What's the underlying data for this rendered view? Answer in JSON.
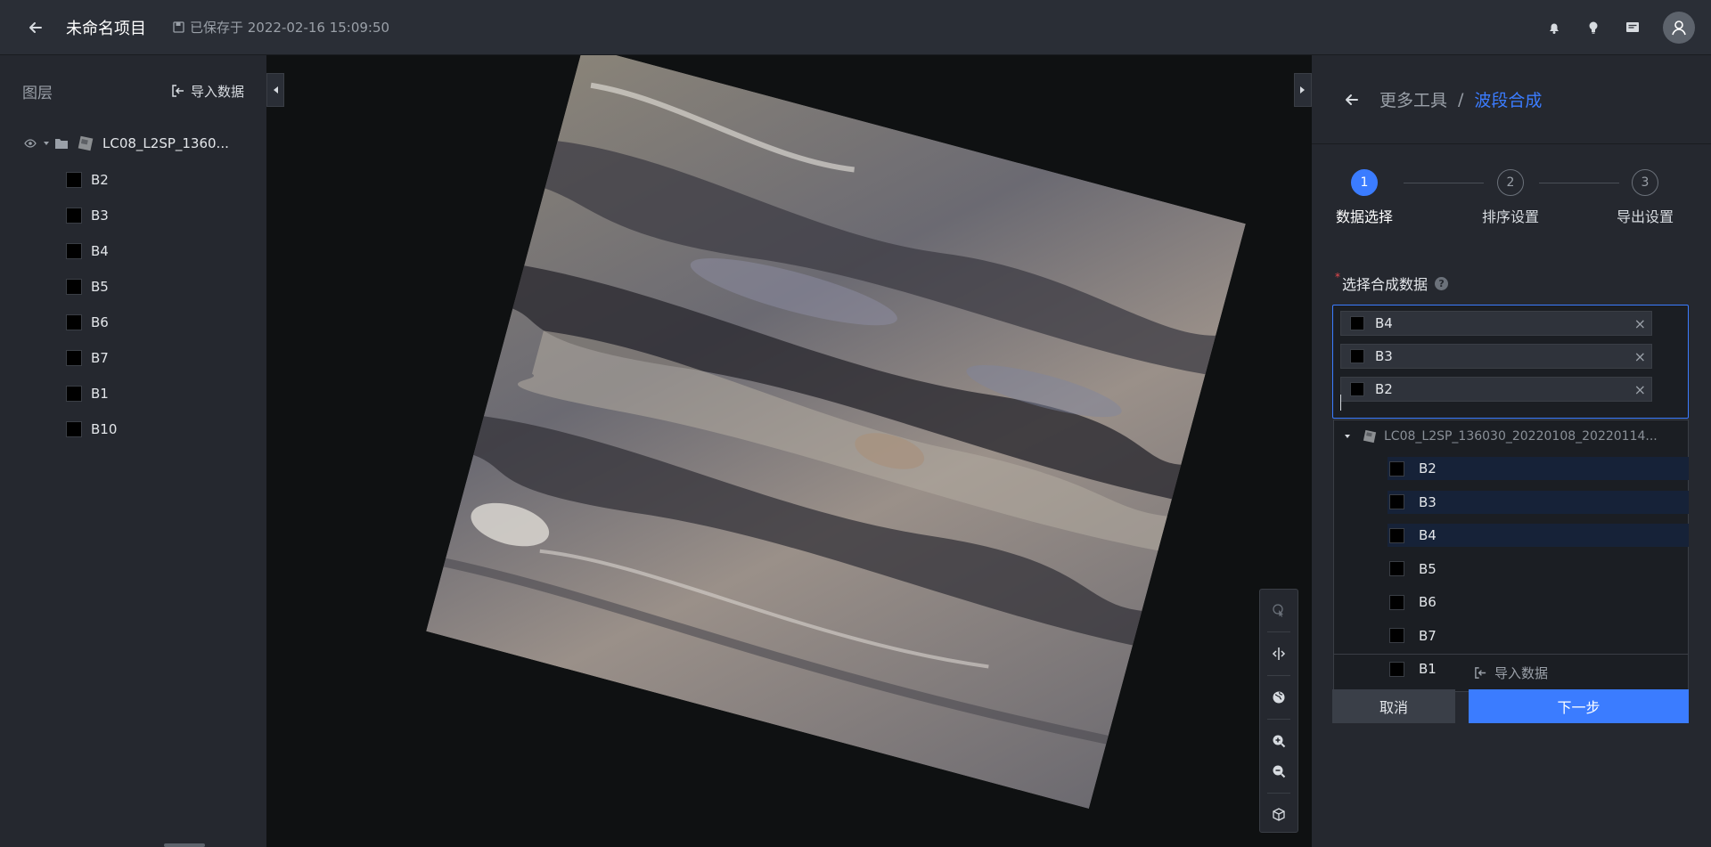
{
  "topbar": {
    "project_title": "未命名项目",
    "saved_text": "已保存于 2022-02-16 15:09:50"
  },
  "left_panel": {
    "title": "图层",
    "import_label": "导入数据",
    "layer_name": "LC08_L2SP_1360...",
    "bands": [
      "B2",
      "B3",
      "B4",
      "B5",
      "B6",
      "B7",
      "B1",
      "B10"
    ]
  },
  "right_panel": {
    "breadcrumb": {
      "parent": "更多工具",
      "separator": "/",
      "current": "波段合成"
    },
    "steps": [
      {
        "num": "1",
        "label": "数据选择"
      },
      {
        "num": "2",
        "label": "排序设置"
      },
      {
        "num": "3",
        "label": "导出设置"
      }
    ],
    "field_label": "选择合成数据",
    "required_mark": "*",
    "help_glyph": "?",
    "selected_tags": [
      "B4",
      "B3",
      "B2"
    ],
    "dropdown": {
      "layer_name": "LC08_L2SP_136030_20220108_20220114...",
      "items": [
        {
          "label": "B2",
          "selected": true
        },
        {
          "label": "B3",
          "selected": true
        },
        {
          "label": "B4",
          "selected": true
        },
        {
          "label": "B5",
          "selected": false
        },
        {
          "label": "B6",
          "selected": false
        },
        {
          "label": "B7",
          "selected": false
        },
        {
          "label": "B1",
          "selected": false
        }
      ],
      "import_label": "导入数据"
    },
    "cancel_label": "取消",
    "next_label": "下一步"
  },
  "colors": {
    "accent": "#3b7cff",
    "panel_bg": "#25282f",
    "topbar_bg": "#2a2e36",
    "map_bg": "#0f1112"
  }
}
